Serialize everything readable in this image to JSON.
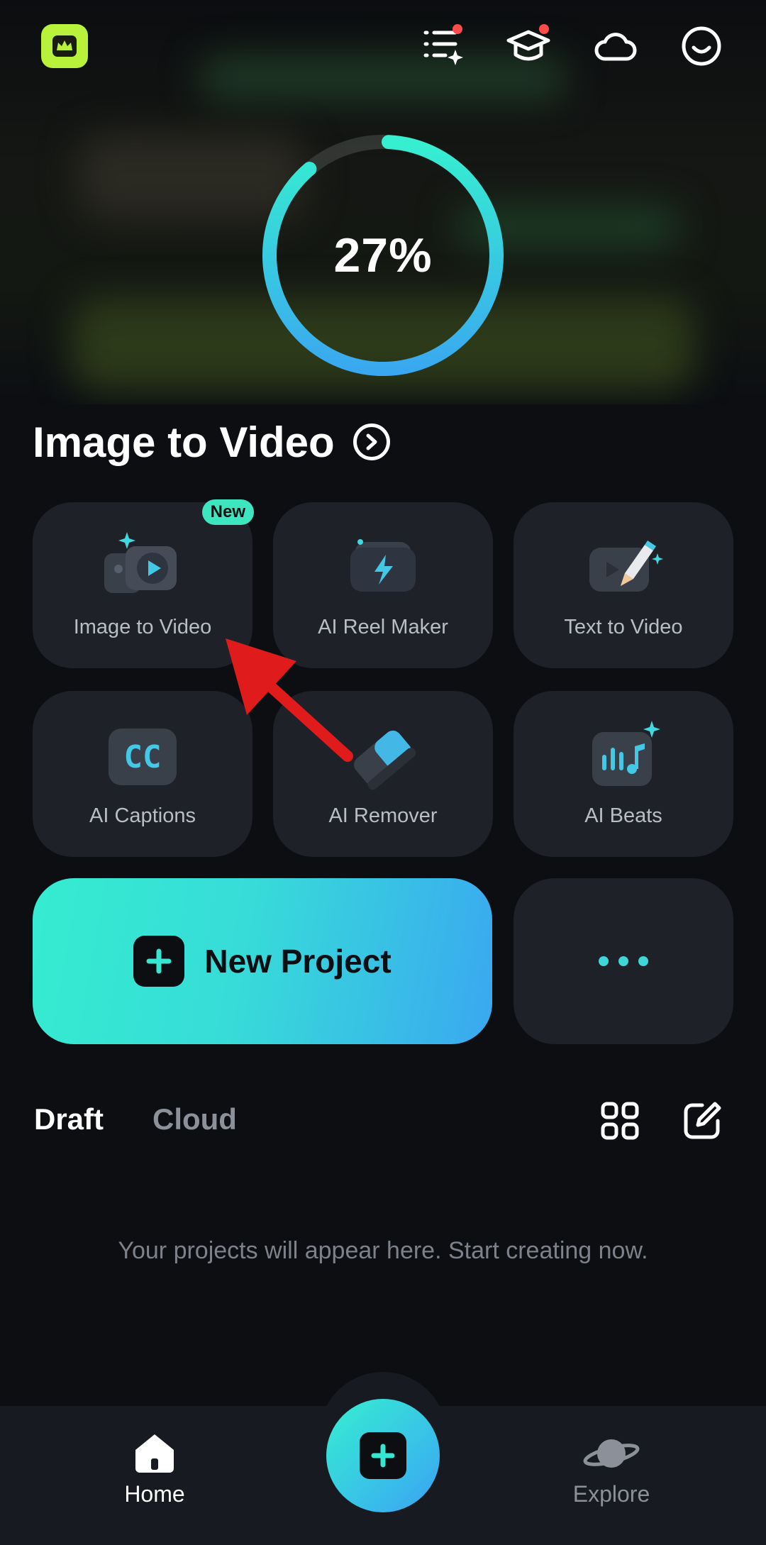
{
  "header": {
    "premium_icon": "crown-icon",
    "icons": [
      "tasks-sparkle-icon",
      "graduation-cap-icon",
      "cloud-icon",
      "smiley-profile-icon"
    ]
  },
  "progress": {
    "value_text": "27%",
    "fraction": 0.27
  },
  "section": {
    "title": "Image to Video"
  },
  "tools": [
    {
      "label": "Image to Video",
      "badge": "New"
    },
    {
      "label": "AI Reel Maker"
    },
    {
      "label": "Text to Video"
    },
    {
      "label": "AI Captions",
      "icon_text": "CC"
    },
    {
      "label": "AI Remover"
    },
    {
      "label": "AI Beats"
    }
  ],
  "new_project": {
    "label": "New Project"
  },
  "tabs": {
    "draft": "Draft",
    "cloud": "Cloud"
  },
  "empty_message": "Your projects will appear here. Start creating now.",
  "nav": {
    "home": "Home",
    "explore": "Explore"
  },
  "colors": {
    "accent": "#36e6d0",
    "accent_blue": "#3aa8f0",
    "badge": "#3ee6c0",
    "premium": "#b8f23a"
  }
}
